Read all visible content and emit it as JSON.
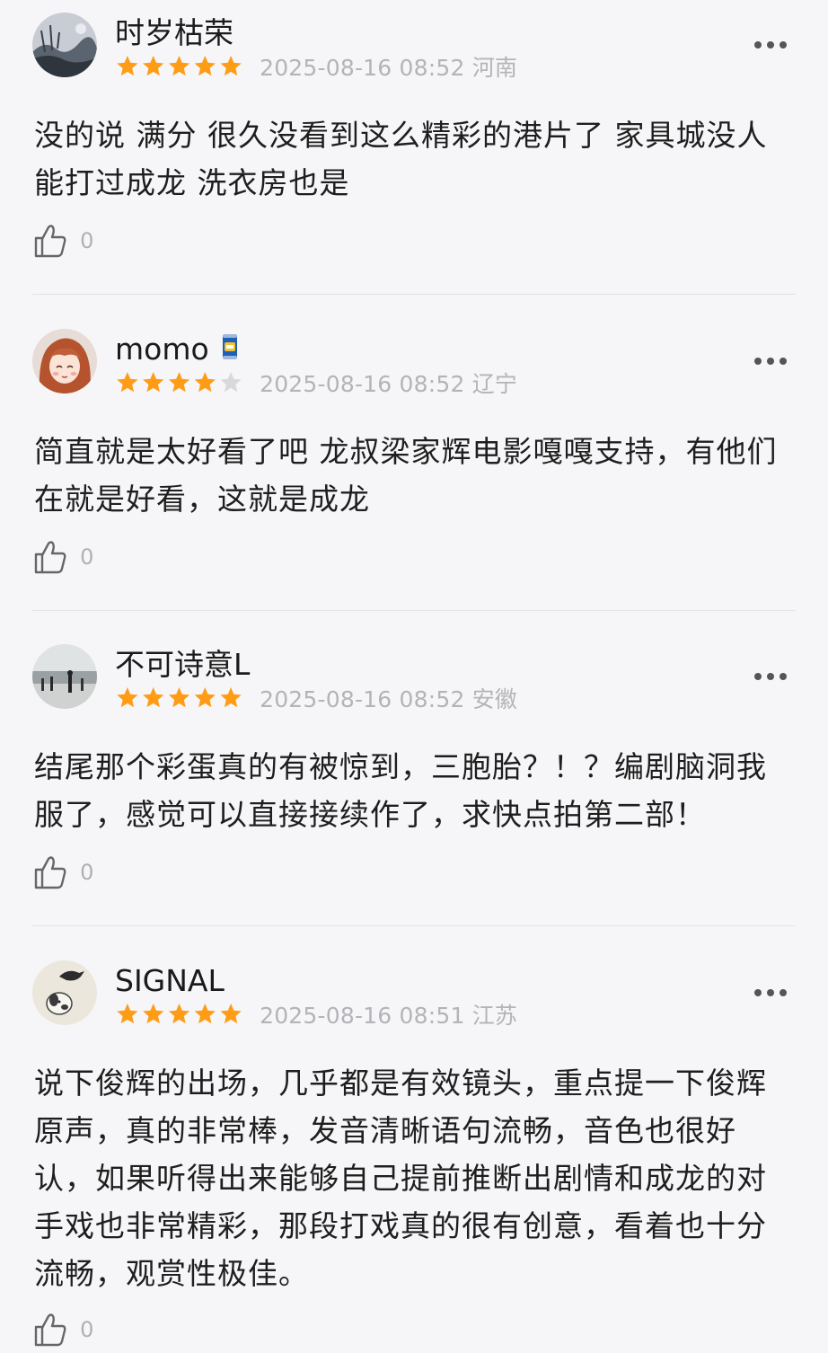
{
  "reviews": [
    {
      "username": "时岁枯荣",
      "rating": 5,
      "meta": "2025-08-16 08:52 河南",
      "text": "没的说 满分 很久没看到这么精彩的港片了 家具城没人能打过成龙 洗衣房也是",
      "likes": "0",
      "avatar": "ink-landscape-avatar",
      "badge": null
    },
    {
      "username": "momo",
      "rating": 4,
      "meta": "2025-08-16 08:52 辽宁",
      "text": "简直就是太好看了吧 龙叔梁家辉电影嘎嘎支持，有他们在就是好看，这就是成龙",
      "likes": "0",
      "avatar": "anime-girl-avatar",
      "badge": "can-badge-icon"
    },
    {
      "username": "不可诗意L",
      "rating": 5,
      "meta": "2025-08-16 08:52 安徽",
      "text": "结尾那个彩蛋真的有被惊到，三胞胎？！？编剧脑洞我服了，感觉可以直接接续作了，求快点拍第二部！",
      "likes": "0",
      "avatar": "beach-photo-avatar",
      "badge": null
    },
    {
      "username": "SIGNAL",
      "rating": 5,
      "meta": "2025-08-16 08:51 江苏",
      "text": "说下俊辉的出场，几乎都是有效镜头，重点提一下俊辉原声，真的非常棒，发音清晰语句流畅，音色也很好认，如果听得出来能够自己提前推断出剧情和成龙的对手戏也非常精彩，那段打戏真的很有创意，看着也十分流畅，观赏性极佳。",
      "likes": "0",
      "avatar": "bird-dog-sketch-avatar",
      "badge": null
    }
  ],
  "colors": {
    "background": "#f6f6f8",
    "star_filled": "#ff9c16",
    "star_empty": "#d9d9dc",
    "meta_text": "#b4b4b8",
    "divider": "#e3e3e6"
  },
  "icons": {
    "more": "more-dots-icon",
    "like": "thumbs-up-icon",
    "star": "star-icon"
  }
}
